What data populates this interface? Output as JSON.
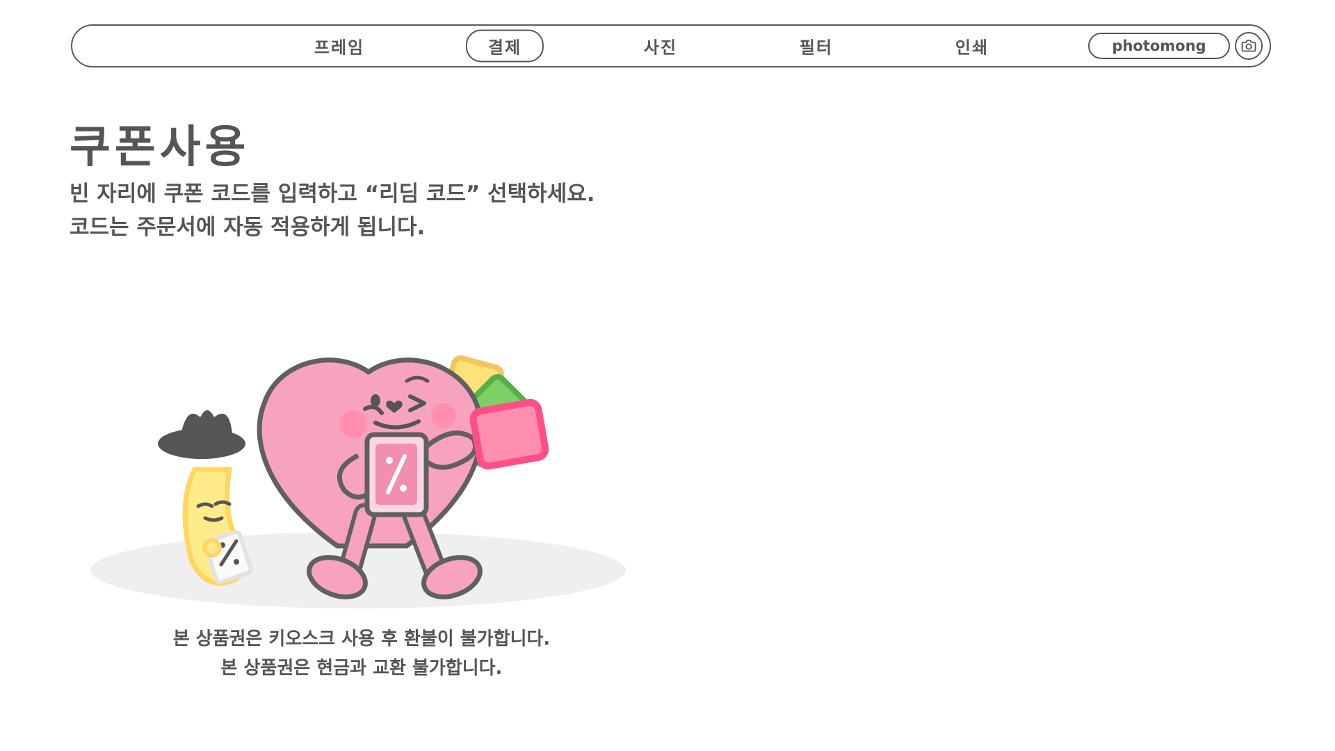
{
  "nav": {
    "items": [
      {
        "label": "프레임",
        "active": false
      },
      {
        "label": "결제",
        "active": true
      },
      {
        "label": "사진",
        "active": false
      },
      {
        "label": "필터",
        "active": false
      },
      {
        "label": "인쇄",
        "active": false
      }
    ],
    "brand": "photomong",
    "camera_icon": "camera-icon"
  },
  "main": {
    "title": "쿠폰사용",
    "description": [
      "빈 자리에 쿠폰 코드를 입력하고 “리딤 코드” 선택하세요.",
      "코드는 주문서에 자동 적용하게 됩니다."
    ],
    "notices": [
      "본 상품권은 키오스크 사용 후 환불이 불가합니다.",
      "본 상품권은 현금과 교환 불가합니다."
    ]
  },
  "colors": {
    "text": "#555555",
    "heart_pink": "#f7a3bd",
    "ticket_pink": "#ff5c8e",
    "ticket_green": "#7dd066",
    "ticket_yellow": "#ffe27a",
    "shadow": "#efefef"
  }
}
